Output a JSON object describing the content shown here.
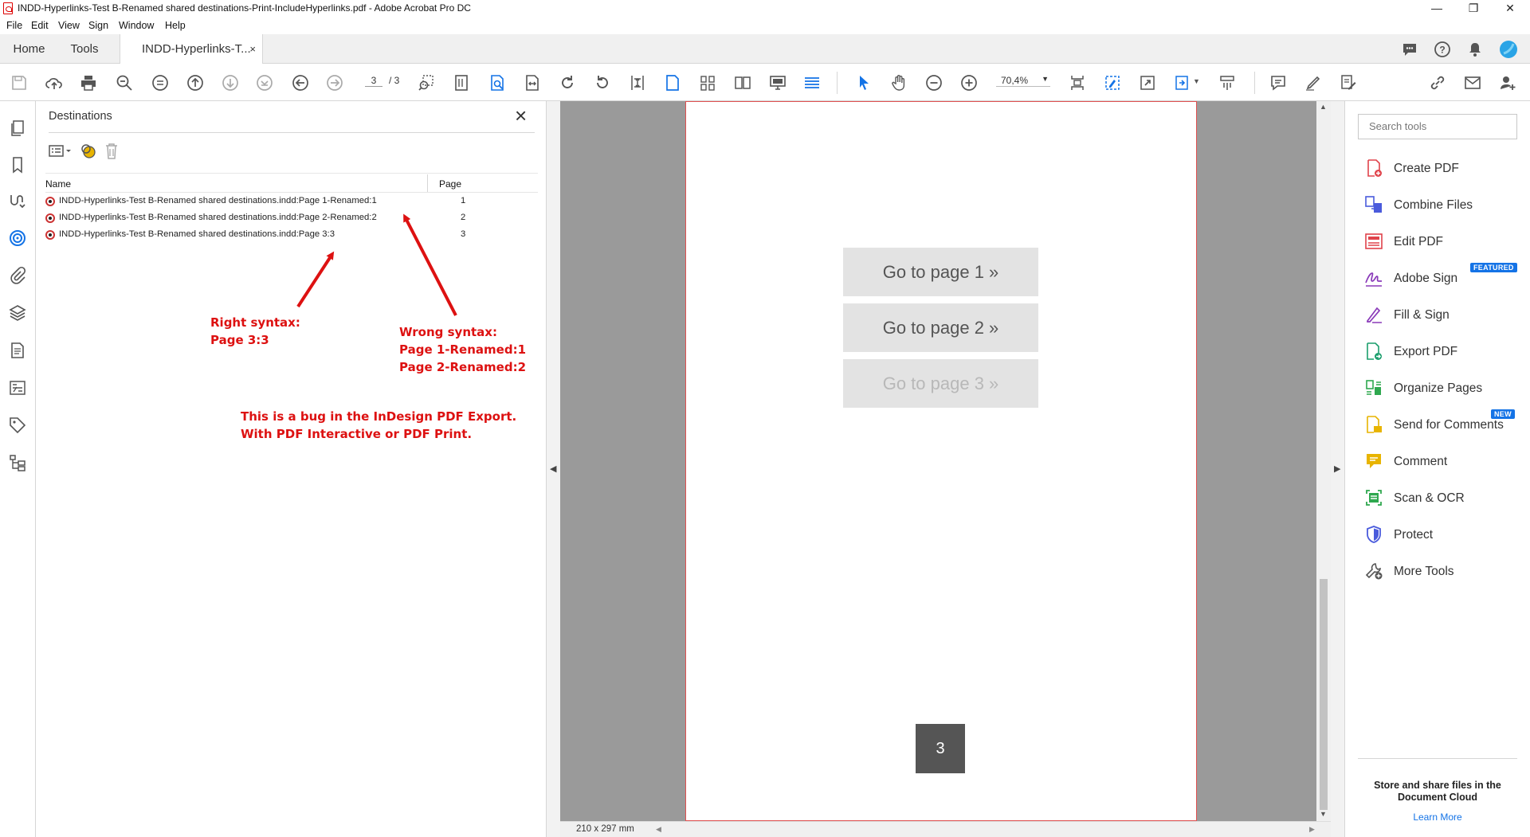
{
  "window": {
    "title": "INDD-Hyperlinks-Test B-Renamed shared destinations-Print-IncludeHyperlinks.pdf - Adobe Acrobat Pro DC",
    "minimize": "—",
    "maximize": "❐",
    "close": "✕"
  },
  "menu": [
    "File",
    "Edit",
    "View",
    "Sign",
    "Window",
    "Help"
  ],
  "tabs": {
    "home": "Home",
    "tools": "Tools",
    "doc": "INDD-Hyperlinks-T...",
    "doc_close": "×"
  },
  "toolbar": {
    "page_current": "3",
    "page_total": "/ 3",
    "zoom": "70,4%"
  },
  "destinations": {
    "title": "Destinations",
    "close": "×",
    "col_name": "Name",
    "col_page": "Page",
    "rows": [
      {
        "name": "INDD-Hyperlinks-Test B-Renamed shared destinations.indd:Page 1-Renamed:1",
        "page": "1"
      },
      {
        "name": "INDD-Hyperlinks-Test B-Renamed shared destinations.indd:Page 2-Renamed:2",
        "page": "2"
      },
      {
        "name": "INDD-Hyperlinks-Test B-Renamed shared destinations.indd:Page 3:3",
        "page": "3"
      }
    ]
  },
  "annotations": {
    "right_1": "Right syntax:",
    "right_2": "Page 3:3",
    "wrong_1": "Wrong syntax:",
    "wrong_2": "Page 1-Renamed:1",
    "wrong_3": "Page 2-Renamed:2",
    "bug_1": "This is a bug in the InDesign PDF Export.",
    "bug_2": "With PDF Interactive or PDF Print."
  },
  "page": {
    "buttons": [
      "Go to page 1 »",
      "Go to page 2 »",
      "Go to page 3 »"
    ],
    "number": "3",
    "size": "210 x 297 mm"
  },
  "tools": {
    "search_placeholder": "Search tools",
    "items": [
      {
        "label": "Create PDF",
        "icon": "create-pdf-icon",
        "color": "#e0434b"
      },
      {
        "label": "Combine Files",
        "icon": "combine-files-icon",
        "color": "#4a5bdc"
      },
      {
        "label": "Edit PDF",
        "icon": "edit-pdf-icon",
        "color": "#e0434b"
      },
      {
        "label": "Adobe Sign",
        "icon": "adobe-sign-icon",
        "color": "#8a3ab9",
        "badge": "FEATURED"
      },
      {
        "label": "Fill & Sign",
        "icon": "fill-sign-icon",
        "color": "#8a3ab9"
      },
      {
        "label": "Export PDF",
        "icon": "export-pdf-icon",
        "color": "#1a9e6c"
      },
      {
        "label": "Organize Pages",
        "icon": "organize-pages-icon",
        "color": "#2fa84f"
      },
      {
        "label": "Send for Comments",
        "icon": "send-comments-icon",
        "color": "#e8b400",
        "badge": "NEW"
      },
      {
        "label": "Comment",
        "icon": "comment-icon",
        "color": "#e8b400"
      },
      {
        "label": "Scan & OCR",
        "icon": "scan-ocr-icon",
        "color": "#2fa84f"
      },
      {
        "label": "Protect",
        "icon": "protect-icon",
        "color": "#4a5bdc"
      },
      {
        "label": "More Tools",
        "icon": "more-tools-icon",
        "color": "#555555"
      }
    ],
    "cloud_text": "Store and share files in the Document Cloud",
    "cloud_link": "Learn More"
  },
  "colors": {
    "accent": "#1473e6",
    "annotation": "#dd1111"
  }
}
